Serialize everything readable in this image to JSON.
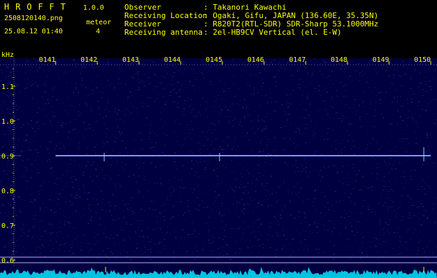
{
  "header": {
    "app_title": "HROFFT",
    "version": "1.0.0",
    "filename": "2508120140.png",
    "meteor_label": "meteor",
    "meteor_count": "4",
    "datetime": "25.08.12 01:40"
  },
  "info": [
    {
      "label": "Observer",
      "value": ": Takanori Kawachi"
    },
    {
      "label": "Receiving Location",
      "value": ": Ogaki, Gifu, JAPAN (136.60E, 35.35N)"
    },
    {
      "label": "Receiver",
      "value": ": R820T2(RTL-SDR) SDR-Sharp 53.1000MHz"
    },
    {
      "label": "Receiving antenna",
      "value": ": 2el-HB9CV Vertical (el. E-W)"
    }
  ],
  "chart_data": {
    "type": "heatmap",
    "ylabel": "kHz",
    "x_ticks": [
      "0141",
      "0142",
      "0143",
      "0144",
      "0145",
      "0146",
      "0147",
      "0148",
      "0149",
      "0150"
    ],
    "y_ticks": [
      "1.1",
      "1.0",
      "0.9",
      "0.8",
      "0.7",
      "0.6"
    ],
    "y_tick_values": [
      1.1,
      1.0,
      0.9,
      0.8,
      0.7,
      0.6
    ],
    "ylim": [
      0.58,
      1.18
    ],
    "carrier_line_khz": 0.9,
    "meteor_count": 4,
    "colors": {
      "background": "#000040",
      "noise": "#2a2aa8",
      "carrier": "#5a9aff",
      "text": "#ffff00",
      "level": "#00e5ff"
    }
  }
}
